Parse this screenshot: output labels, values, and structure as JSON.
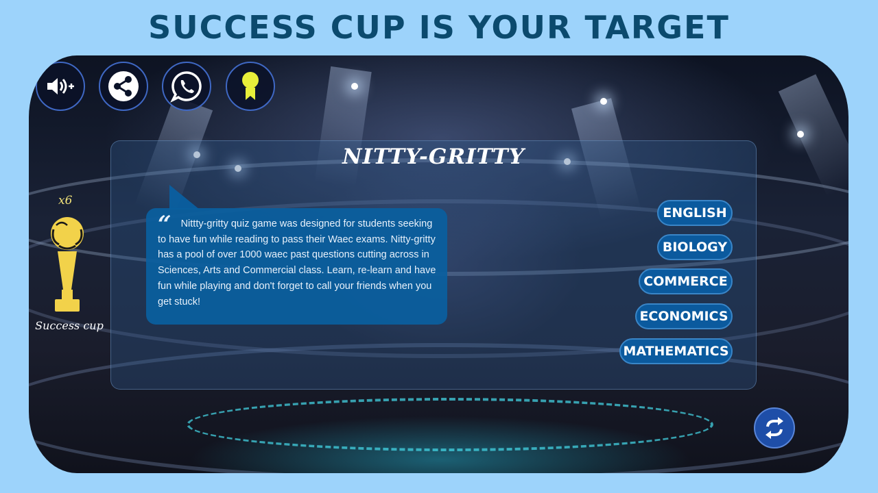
{
  "header": {
    "title": "SUCCESS CUP IS YOUR TARGET"
  },
  "toolbar": {
    "icons": [
      {
        "name": "sound-plus-icon"
      },
      {
        "name": "share-icon"
      },
      {
        "name": "whatsapp-icon"
      },
      {
        "name": "achievement-ribbon-icon"
      }
    ]
  },
  "panel": {
    "title": "NITTY-GRITTY",
    "description": "Nittty-gritty quiz game was designed for students seeking to have fun while reading to pass their Waec exams. Nitty-gritty has a pool of over 1000 waec past questions cutting across in Sciences, Arts and Commercial class. Learn, re-learn and have fun while playing and don't forget to call your friends when you get stuck!",
    "quote_mark": "“"
  },
  "subjects": [
    "ENGLISH",
    "BIOLOGY",
    "COMMERCE",
    "ECONOMICS",
    "MATHEMATICS"
  ],
  "trophy": {
    "count": "x6",
    "label": "Success cup"
  },
  "colors": {
    "background": "#9dd3fb",
    "headline": "#0b4a6e",
    "subject_button": "#0b5a9e",
    "trophy": "#f2d24a",
    "ribbon": "#e8ef3a"
  },
  "refresh": {
    "icon": "refresh-icon"
  }
}
